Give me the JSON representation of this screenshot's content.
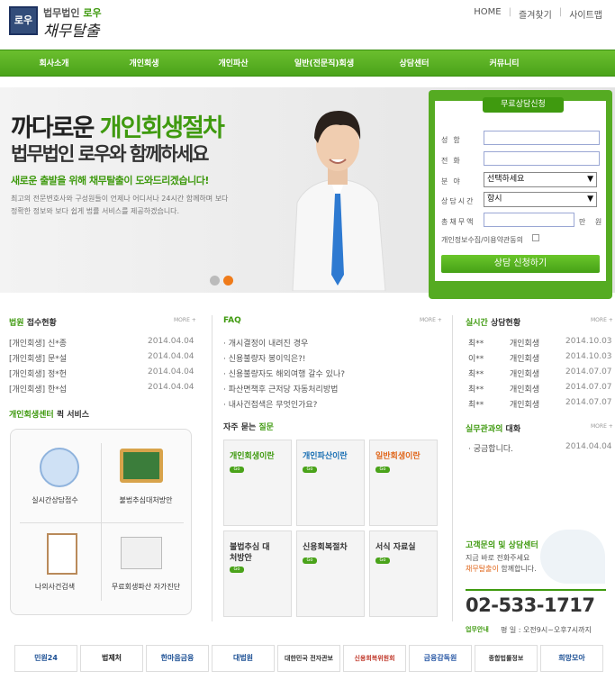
{
  "header": {
    "logo_text": "로우",
    "firm_name": "법무법인",
    "firm_name_accent": "로우",
    "brand": "채무탈출",
    "top_nav": [
      "HOME",
      "즐겨찾기",
      "사이트맵"
    ]
  },
  "gnb": [
    "회사소개",
    "개인회생",
    "개인파산",
    "일반(전문직)회생",
    "상담센터",
    "커뮤니티"
  ],
  "hero": {
    "line1_a": "까다로운",
    "line1_b": "개인회생절차",
    "line2": "법무법인 로우와 함께하세요",
    "line3": "새로운 출발을 위해 채무탈출이 도와드리겠습니다!",
    "line4": "최고의 전문변호사와 구성원들이 언제나 어디서나 24시간 함께하며 보다 정확한 정보와 보다 쉽게 법률 서비스를 제공하겠습니다."
  },
  "form": {
    "title": "무료상담신청",
    "name_label": "성함",
    "phone_label": "전화",
    "category_label": "분야",
    "category_value": "선택하세요",
    "time_label": "상담시간",
    "time_value": "항시",
    "debt_label": "총채무액",
    "debt_unit": "만 원",
    "agree_label": "개인정보수집/이용약관동의",
    "submit": "상담 신청하기"
  },
  "court": {
    "title_a": "법원",
    "title_b": "접수현황",
    "more": "MORE +",
    "rows": [
      {
        "text": "[개인회생] 신*종",
        "date": "2014.04.04"
      },
      {
        "text": "[개인회생] 문*설",
        "date": "2014.04.04"
      },
      {
        "text": "[개인회생] 정*헌",
        "date": "2014.04.04"
      },
      {
        "text": "[개인회생] 한*섭",
        "date": "2014.04.04"
      }
    ]
  },
  "quick": {
    "title_a": "개인회생센터",
    "title_b": "퀵 서비스",
    "items": [
      "실시간상담접수",
      "불법추심대처방안",
      "나의사건검색",
      "무료회생파산 자가진단"
    ]
  },
  "faq": {
    "title": "FAQ",
    "more": "MORE +",
    "rows": [
      "개시결정이 내려진 경우",
      "신용불량자 봉이익은?!",
      "신용불량자도 해외여행 갈수 있나?",
      "파산면책후 근저당 자동처리방법",
      "내사건접색은 무엇인가요?"
    ],
    "sub_a": "자주 묻는",
    "sub_b": "질문",
    "tiles": [
      {
        "title": "개인회생이란",
        "color": "#3f9a0f"
      },
      {
        "title": "개인파산이란",
        "color": "#1a6fb3"
      },
      {
        "title": "일반회생이란",
        "color": "#e0661a"
      },
      {
        "title": "불법추심 대처방안",
        "color": "#333333"
      },
      {
        "title": "신용회복절차",
        "color": "#333333"
      },
      {
        "title": "서식 자료실",
        "color": "#333333"
      }
    ],
    "go": "Go"
  },
  "realtime": {
    "title_a": "실시간",
    "title_b": "상담현황",
    "more": "MORE +",
    "rows": [
      {
        "name": "최**",
        "type": "개인회생",
        "date": "2014.10.03"
      },
      {
        "name": "이**",
        "type": "개인회생",
        "date": "2014.10.03"
      },
      {
        "name": "최**",
        "type": "개인회생",
        "date": "2014.07.07"
      },
      {
        "name": "최**",
        "type": "개인회생",
        "date": "2014.07.07"
      },
      {
        "name": "최**",
        "type": "개인회생",
        "date": "2014.07.07"
      }
    ]
  },
  "chat": {
    "title_a": "실무관과의",
    "title_b": "대화",
    "more": "MORE +",
    "rows": [
      {
        "text": "궁금합니다.",
        "date": "2014.04.04"
      }
    ]
  },
  "contact": {
    "title": "고객문의 및 상담센터",
    "line1": "지금 바로 전화주세요",
    "line2_a": "채무탈출이",
    "line2_b": "함께합니다.",
    "phone": "02-533-1717",
    "hours_label": "업무안내",
    "hours": "평 일 : 오전9시~오후7시까지"
  },
  "banners": [
    "민원24",
    "법제처",
    "한마음금융",
    "대법원",
    "대한민국 전자관보",
    "신용회복위원회",
    "금융감독원",
    "종합법률정보",
    "희망모아"
  ]
}
